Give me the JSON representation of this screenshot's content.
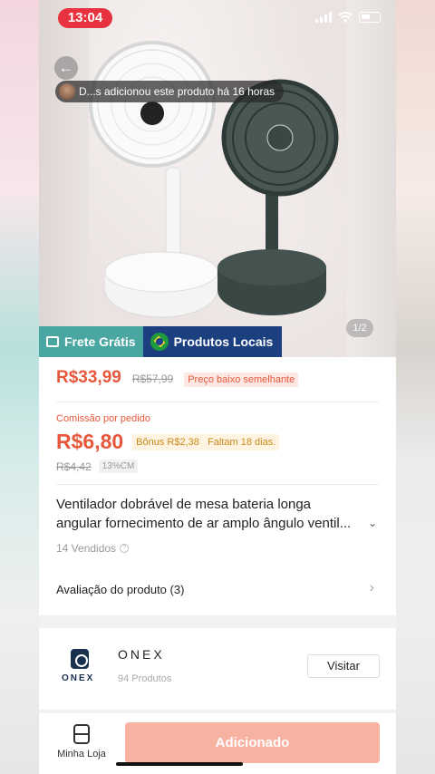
{
  "status_bar": {
    "time": "13:04"
  },
  "hero": {
    "activity_toast": "D...s adicionou este produto há 16 horas",
    "image_counter": "1/2",
    "tags": {
      "free_shipping": "Frete Grátis",
      "local_products": "Produtos Locais"
    }
  },
  "price": {
    "current": "R$33,99",
    "original": "R$57,99",
    "badge": "Preço baixo semelhante"
  },
  "commission": {
    "label": "Comissão por pedido",
    "value": "R$6,80",
    "bonus": "Bônus R$2,38",
    "days_left": "Faltam 18 dias.",
    "old_value": "R$4,42",
    "rate": "13%CM"
  },
  "product": {
    "title_line1": "Ventilador dobrável de mesa bateria longa",
    "title_line2": "angular fornecimento de ar amplo ângulo ventil...",
    "sold": "14 Vendidos",
    "review_label": "Avaliação do produto (3)"
  },
  "shop": {
    "logo_text": "ONEX",
    "name": "ONEX",
    "product_count": "94 Produtos",
    "visit_label": "Visitar"
  },
  "bottom_bar": {
    "my_store_label": "Minha Loja",
    "added_label": "Adicionado"
  },
  "colors": {
    "accent": "#e7573b",
    "free_shipping": "#4aa6a1",
    "local_products": "#1c3f7f",
    "added_button": "#f7b2a2"
  }
}
